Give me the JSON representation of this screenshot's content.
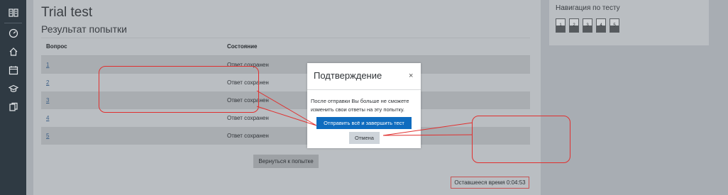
{
  "page": {
    "title": "Trial test",
    "subtitle": "Результат попытки"
  },
  "sidebar": {
    "icons": [
      "book-icon",
      "dashboard-icon",
      "home-icon",
      "calendar-icon",
      "graduation-cap-icon",
      "files-icon"
    ]
  },
  "table": {
    "headers": {
      "question": "Вопрос",
      "status": "Состояние"
    },
    "rows": [
      {
        "question": "1",
        "status": "Ответ сохранен"
      },
      {
        "question": "2",
        "status": "Ответ сохранен"
      },
      {
        "question": "3",
        "status": "Ответ сохранен"
      },
      {
        "question": "4",
        "status": "Ответ сохранен"
      },
      {
        "question": "5",
        "status": "Ответ сохранен"
      }
    ]
  },
  "actions": {
    "back_label": "Вернуться к попытке"
  },
  "timer": {
    "label": "Оставшееся время 0:04:53"
  },
  "nav": {
    "title": "Навигация по тесту",
    "buttons": [
      "1",
      "2",
      "3",
      "4",
      "5"
    ]
  },
  "modal": {
    "title": "Подтверждение",
    "close_glyph": "×",
    "message": "После отправки Вы больше не сможете изменить свои ответы на эту попытку.",
    "submit_label": "Отправить всё и завершить тест",
    "cancel_label": "Отмена"
  },
  "colors": {
    "annotation": "#e0302f",
    "primary": "#0f6cbf",
    "sidebar": "#2f3a43"
  }
}
